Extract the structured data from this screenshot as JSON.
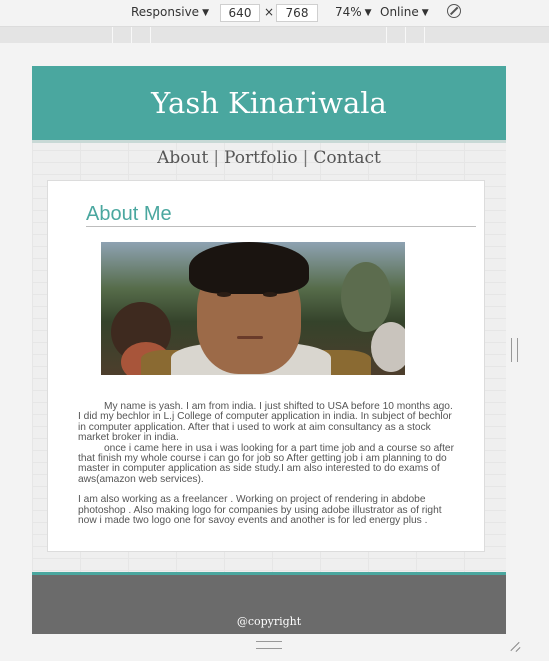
{
  "devtools": {
    "device": "Responsive",
    "width": "640",
    "times": "×",
    "height": "768",
    "zoom": "74%",
    "throttle": "Online",
    "caret": "▼",
    "rotate_icon": "rotate-icon"
  },
  "site": {
    "title": "Yash Kinariwala",
    "nav": [
      "About",
      "Portfolio",
      "Contact"
    ],
    "separator": "|"
  },
  "about": {
    "heading": "About Me",
    "p1": "My name is yash. I am from india. I just shifted to USA before 10 months ago. I did my bechlor in L.j College of computer application in india. In subject of bechlor in computer application. After that i used to work at aim consultancy as a stock market broker in india.",
    "p2": "once i came here in usa i was looking for a part time job and a course so after that finish my whole course i can go for job so After getting job i am planning to do master in computer application as side study.I am also interested to do exams of aws(amazon web services).",
    "p3": "I am also working as a freelancer . Working on project of rendering in abdobe photoshop . Also making logo for companies by using adobe illustrator as of right now i made two logo one for savoy events and another is for led energy plus ."
  },
  "footer": {
    "copyright": "@copyright"
  },
  "colors": {
    "accent": "#4aa79f",
    "footer": "#6b6b6b"
  }
}
